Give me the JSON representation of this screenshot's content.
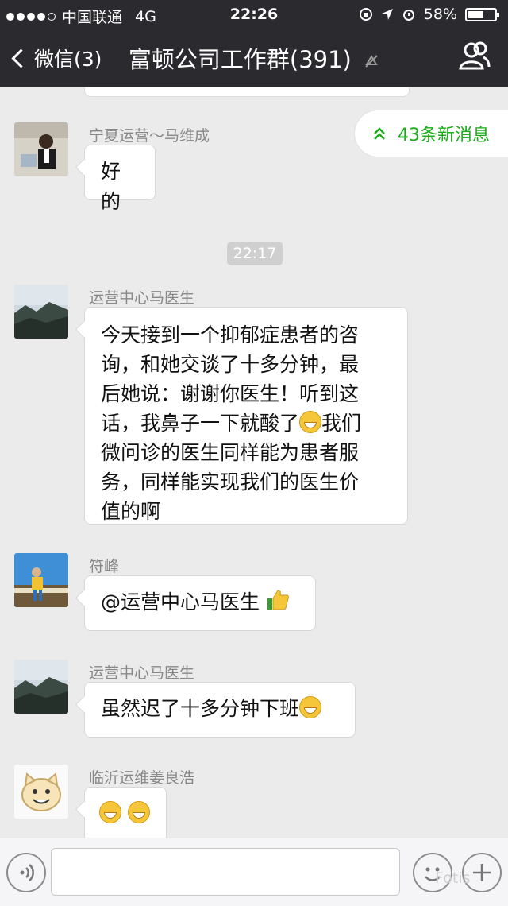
{
  "status_bar": {
    "carrier": "中国联通",
    "network": "4G",
    "time": "22:26",
    "battery": "58%",
    "battery_level": 0.58
  },
  "nav": {
    "back_label": "微信(3)",
    "title": "富顿公司工作群(391)"
  },
  "new_messages": {
    "label": "43条新消息"
  },
  "timestamp": "22:17",
  "messages": [
    {
      "sender": "宁夏运营～马维成",
      "text": "好的"
    },
    {
      "sender": "运营中心马医生",
      "lines": [
        "今天接到一个抑郁症患者的咨",
        "询，和她交谈了十多分钟，最",
        "后她说：谢谢你医生！听到这",
        "话，我鼻子一下就酸了",
        "微问诊的医生同样能为患者服",
        "务，同样能实现我们的医生价",
        "值的啊"
      ],
      "line4_suffix": "我们"
    },
    {
      "sender": "符峰",
      "text": "@运营中心马医生"
    },
    {
      "sender": "运营中心马医生",
      "text": "虽然迟了十多分钟下班"
    },
    {
      "sender": "临沂运维姜良浩",
      "text": ""
    }
  ],
  "watermark": "Fotis",
  "colors": {
    "bar_bg": "#2b2b2f",
    "chat_bg": "#ebebeb",
    "accent_green": "#1aad19"
  }
}
